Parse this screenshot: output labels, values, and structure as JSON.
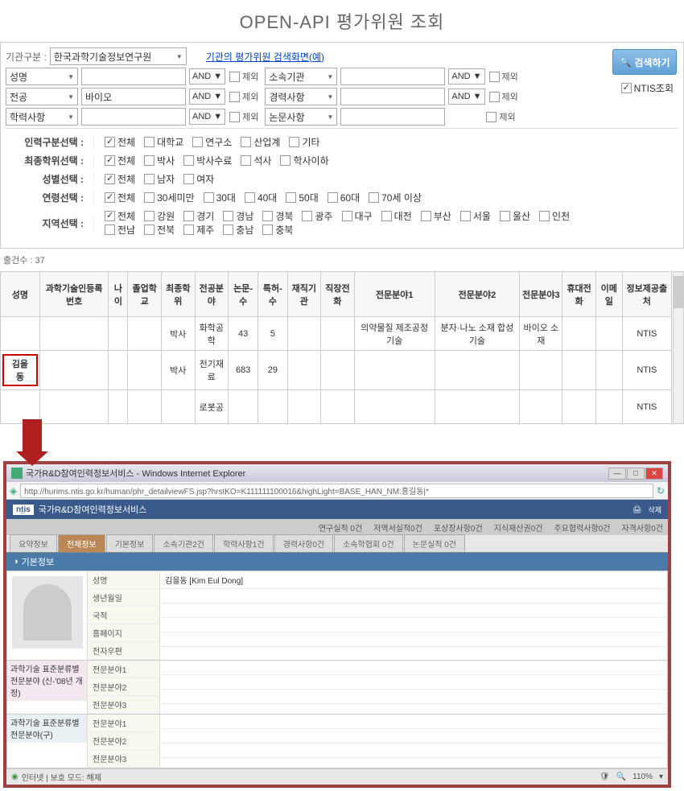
{
  "title": "OPEN-API 평가위원 조회",
  "form": {
    "org_label": "기관구분 :",
    "org_value": "한국과학기술정보연구원",
    "example_link": "기관의 평가위원 검색화면(예)",
    "name_label": "성명",
    "and": "AND",
    "exclude": "제외",
    "affil_label": "소속기관",
    "major_label": "전공",
    "major_value": "바이오",
    "career_label": "경력사항",
    "edu_label": "학력사항",
    "paper_label": "논문사항",
    "search_btn": "검색하기",
    "ntis_check": "NTIS조회"
  },
  "filters": {
    "type_label": "인력구분선택 :",
    "type_opts": [
      "전체",
      "대학교",
      "연구소",
      "산업계",
      "기타"
    ],
    "degree_label": "최종학위선택 :",
    "degree_opts": [
      "전체",
      "박사",
      "박사수료",
      "석사",
      "학사이하"
    ],
    "gender_label": "성별선택 :",
    "gender_opts": [
      "전체",
      "남자",
      "여자"
    ],
    "age_label": "연령선택 :",
    "age_opts": [
      "전체",
      "30세미만",
      "30대",
      "40대",
      "50대",
      "60대",
      "70세 이상"
    ],
    "region_label": "지역선택 :",
    "region_opts_r1": [
      "전체",
      "강원",
      "경기",
      "경남",
      "경북",
      "광주",
      "대구",
      "대전",
      "부산",
      "서울",
      "울산",
      "인천"
    ],
    "region_opts_r2": [
      "전남",
      "전북",
      "제주",
      "충남",
      "충북"
    ]
  },
  "count": "출건수 : 37",
  "cols": [
    "성명",
    "과학기술인등록번호",
    "나이",
    "졸업학교",
    "최종학위",
    "전공분야",
    "논문-수",
    "특허-수",
    "재직기관",
    "직장전화",
    "전문분야1",
    "전문분야2",
    "전문분야3",
    "휴대전화",
    "이메일",
    "정보제공출처"
  ],
  "rows": [
    {
      "name": "",
      "reg": "",
      "age": "",
      "school": "",
      "degree": "박사",
      "major": "화학공학",
      "papers": "43",
      "patents": "5",
      "org": "",
      "tel": "",
      "sp1": "의약물질 제조공정 기술",
      "sp2": "분자·나노 소재 합성 기술",
      "sp3": "바이오 소재",
      "mobile": "",
      "email": "",
      "src": "NTIS"
    },
    {
      "name": "김을동",
      "reg": "",
      "age": "",
      "school": "",
      "degree": "박사",
      "major": "전기재료",
      "papers": "683",
      "patents": "29",
      "org": "",
      "tel": "",
      "sp1": "",
      "sp2": "",
      "sp3": "",
      "mobile": "",
      "email": "",
      "src": "NTIS"
    },
    {
      "name": "",
      "reg": "",
      "age": "",
      "school": "",
      "degree": "",
      "major": "로봇공",
      "papers": "",
      "patents": "",
      "org": "",
      "tel": "",
      "sp1": "",
      "sp2": "",
      "sp3": "",
      "mobile": "",
      "email": "",
      "src": "NTIS"
    }
  ],
  "popup": {
    "win_title": "국가R&D참여인력정보서비스 - Windows Internet Explorer",
    "url": "http://hurims.ntis.go.kr/human/phr_detailviewFS.jsp?hrstKO=K111111100016&highLight=BASE_HAN_NM:홍길동|*",
    "service_title": "국가R&D참여인력정보서비스",
    "nav_tabs": [
      "연구실적 0건",
      "저역서실적0건",
      "포상장사항0건",
      "지식재산권0건",
      "주요협력사항0건",
      "자격사항0건"
    ],
    "sub_tabs": [
      "요약정보",
      "전체정보",
      "기본정보",
      "소속기관2건",
      "학력사항1건",
      "경력사항0건",
      "소속학협회 0건",
      "논문실적 0건"
    ],
    "info_header": "기본정보",
    "info_labels": [
      "성명",
      "생년월일",
      "국적",
      "홈페이지",
      "전자우편"
    ],
    "name_value": "김을동  [Kim Eul Dong]",
    "group1_title": "과학기술 표준분류별 전문분야 (신-'08년 개정)",
    "group1_items": [
      "전문분야1",
      "전문분야2",
      "전문분야3"
    ],
    "group2_title": "과학기술 표준분류별 전문분야(구)",
    "group2_items": [
      "전문분야1",
      "전문분야2",
      "전문분야3"
    ],
    "status_text": "인터넷 | 보호 모드: 해제",
    "zoom": "110%"
  }
}
